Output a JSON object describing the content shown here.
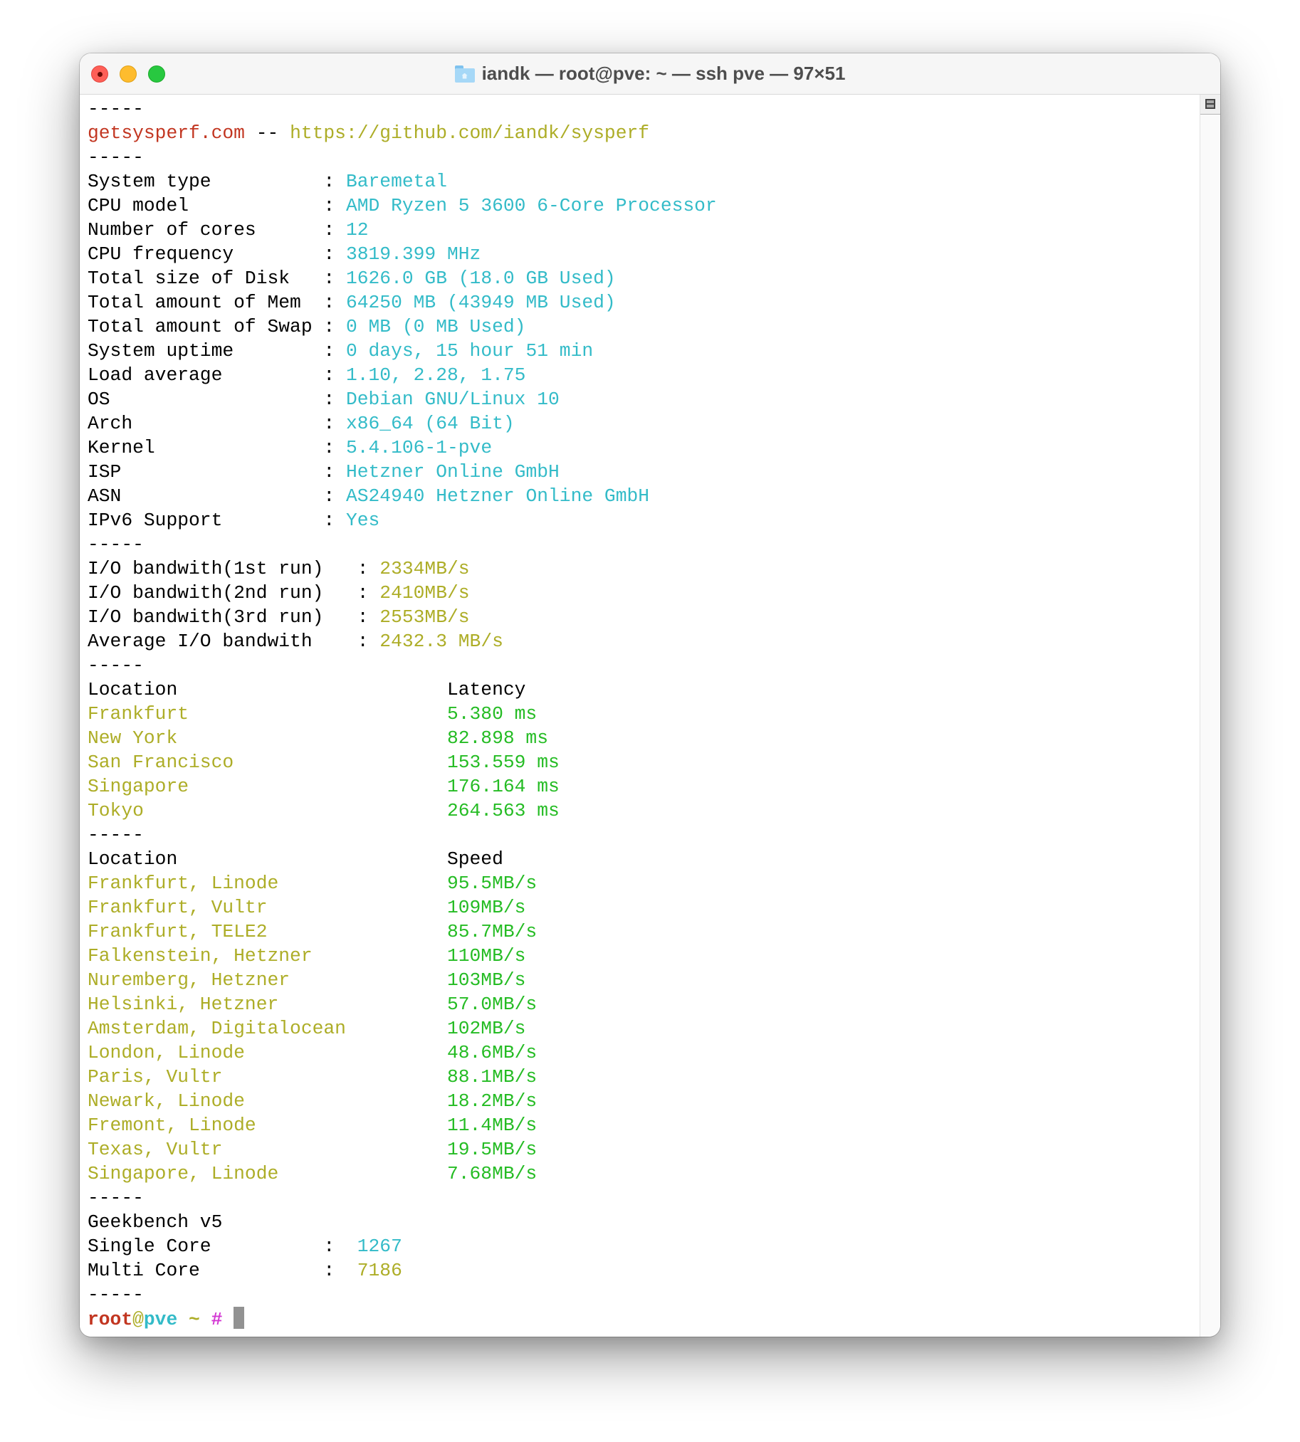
{
  "window": {
    "title": "iandk — root@pve: ~ — ssh pve — 97×51",
    "title_icon": "home-folder-icon",
    "buttons": {
      "close": "close",
      "minimize": "minimize",
      "zoom": "zoom"
    }
  },
  "colors": {
    "red": "#c23621",
    "yellow": "#adad27",
    "cyan": "#33bbc8",
    "green": "#25bc24",
    "magenta": "#d338d3",
    "cursor": "#929292"
  },
  "separator": "-----",
  "header": {
    "site": "getsysperf.com",
    "dash": "--",
    "repo_url": "https://github.com/iandk/sysperf"
  },
  "system_info": [
    {
      "label": "System type",
      "value": "Baremetal"
    },
    {
      "label": "CPU model",
      "value": "AMD Ryzen 5 3600 6-Core Processor"
    },
    {
      "label": "Number of cores",
      "value": "12"
    },
    {
      "label": "CPU frequency",
      "value": "3819.399 MHz"
    },
    {
      "label": "Total size of Disk",
      "value": "1626.0 GB (18.0 GB Used)"
    },
    {
      "label": "Total amount of Mem",
      "value": "64250 MB (43949 MB Used)"
    },
    {
      "label": "Total amount of Swap",
      "value": "0 MB (0 MB Used)"
    },
    {
      "label": "System uptime",
      "value": "0 days, 15 hour 51 min"
    },
    {
      "label": "Load average",
      "value": "1.10, 2.28, 1.75"
    },
    {
      "label": "OS",
      "value": "Debian GNU/Linux 10"
    },
    {
      "label": "Arch",
      "value": "x86_64 (64 Bit)"
    },
    {
      "label": "Kernel",
      "value": "5.4.106-1-pve"
    },
    {
      "label": "ISP",
      "value": "Hetzner Online GmbH"
    },
    {
      "label": "ASN",
      "value": "AS24940 Hetzner Online GmbH"
    },
    {
      "label": "IPv6 Support",
      "value": "Yes"
    }
  ],
  "io": [
    {
      "label": "I/O bandwith(1st run)",
      "value": "2334MB/s"
    },
    {
      "label": "I/O bandwith(2nd run)",
      "value": "2410MB/s"
    },
    {
      "label": "I/O bandwith(3rd run)",
      "value": "2553MB/s"
    },
    {
      "label": "Average I/O bandwith",
      "value": "2432.3 MB/s"
    }
  ],
  "latency": {
    "col_location": "Location",
    "col_value": "Latency",
    "rows": [
      {
        "location": "Frankfurt",
        "value": "5.380 ms"
      },
      {
        "location": "New York",
        "value": "82.898 ms"
      },
      {
        "location": "San Francisco",
        "value": "153.559 ms"
      },
      {
        "location": "Singapore",
        "value": "176.164 ms"
      },
      {
        "location": "Tokyo",
        "value": "264.563 ms"
      }
    ]
  },
  "speed": {
    "col_location": "Location",
    "col_value": "Speed",
    "rows": [
      {
        "location": "Frankfurt, Linode",
        "value": "95.5MB/s"
      },
      {
        "location": "Frankfurt, Vultr",
        "value": "109MB/s"
      },
      {
        "location": "Frankfurt, TELE2",
        "value": "85.7MB/s"
      },
      {
        "location": "Falkenstein, Hetzner",
        "value": "110MB/s"
      },
      {
        "location": "Nuremberg, Hetzner",
        "value": "103MB/s"
      },
      {
        "location": "Helsinki, Hetzner",
        "value": "57.0MB/s"
      },
      {
        "location": "Amsterdam, Digitalocean",
        "value": "102MB/s"
      },
      {
        "location": "London, Linode",
        "value": "48.6MB/s"
      },
      {
        "location": "Paris, Vultr",
        "value": "88.1MB/s"
      },
      {
        "location": "Newark, Linode",
        "value": "18.2MB/s"
      },
      {
        "location": "Fremont, Linode",
        "value": "11.4MB/s"
      },
      {
        "location": "Texas, Vultr",
        "value": "19.5MB/s"
      },
      {
        "location": "Singapore, Linode",
        "value": "7.68MB/s"
      }
    ]
  },
  "geekbench": {
    "title": "Geekbench v5",
    "single_label": "Single Core",
    "single_value": "1267",
    "multi_label": "Multi Core",
    "multi_value": "7186"
  },
  "prompt": {
    "user": "root",
    "at": "@",
    "host": "pve",
    "cwd": "~",
    "symbol": "#"
  },
  "colon": ":"
}
